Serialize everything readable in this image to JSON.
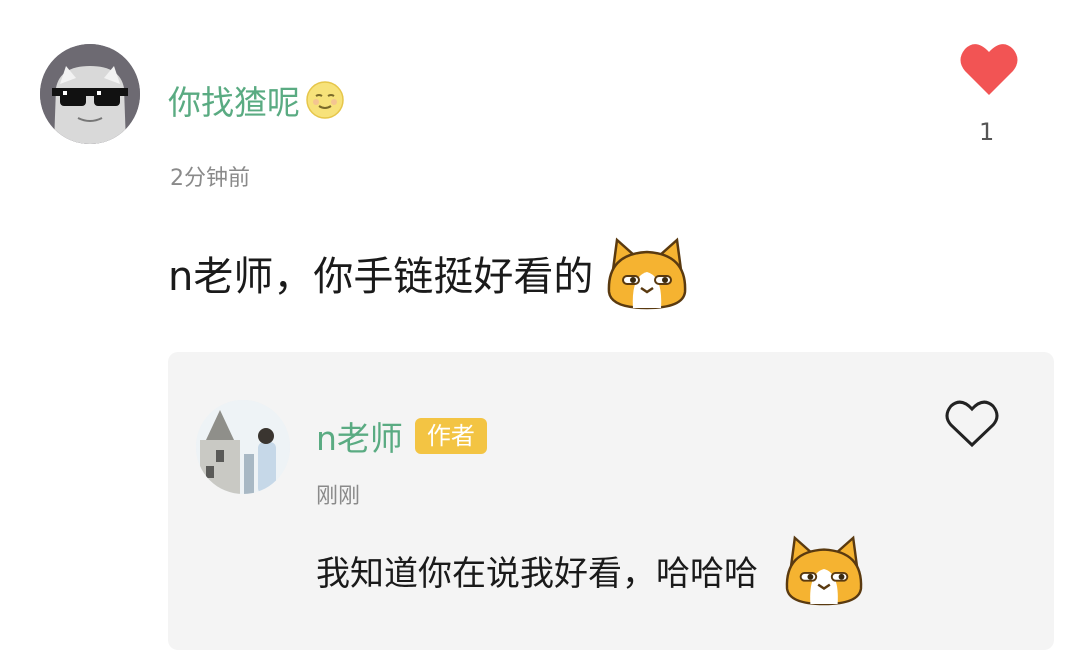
{
  "comment": {
    "username": "你找猹呢",
    "time": "2分钟前",
    "text": "n老师，你手链挺好看的",
    "like_count": "1",
    "liked": true,
    "emoji_icon": "smiling-moon-face-icon",
    "sticker": "shiba-cat-sticker"
  },
  "reply": {
    "username": "n老师",
    "badge": "作者",
    "time": "刚刚",
    "text": "我知道你在说我好看，哈哈哈",
    "liked": false,
    "sticker": "shiba-cat-sticker"
  },
  "colors": {
    "username": "#5aab82",
    "like_active": "#f25454",
    "badge_bg": "#f3c443",
    "reply_bg": "#f4f4f4"
  }
}
